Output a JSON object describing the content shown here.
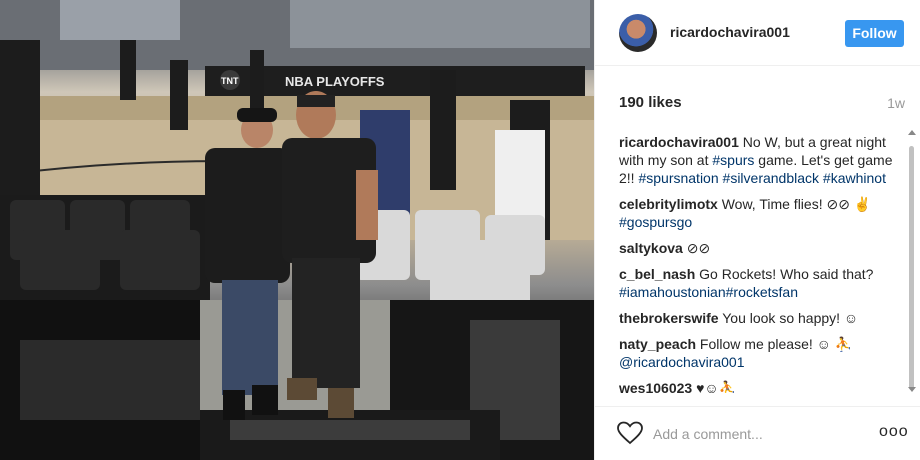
{
  "post": {
    "username": "ricardochavira001",
    "follow_label": "Follow",
    "likes": "190 likes",
    "age": "1w",
    "comment_placeholder": "Add a comment...",
    "more_label": "ooo"
  },
  "photo": {
    "court_banner": "NBA PLAYOFFS",
    "tnt_logo": "TNT"
  },
  "comments": [
    {
      "user": "ricardochavira001",
      "text": " No W, but a great night with my son at ",
      "tags": [
        "#spurs",
        "#spursnation",
        "#silverandblack",
        "#kawhinot"
      ],
      "text2": " game. Let's get game 2!! "
    },
    {
      "user": "celebritylimotx",
      "text": " Wow, Time flies! ⊘⊘ ",
      "tags": [
        "#gospursgo"
      ],
      "emoji": "✌"
    },
    {
      "user": "saltykova",
      "text": " ⊘⊘"
    },
    {
      "user": "c_bel_nash",
      "text": " Go Rockets! Who said that? ",
      "tags": [
        "#iamahoustonian#rocketsfan"
      ]
    },
    {
      "user": "thebrokerswife",
      "text": " You look so happy! ☺"
    },
    {
      "user": "naty_peach",
      "text": " Follow me please! ☺ ⛹ ",
      "tags": [
        "@ricardochavira001"
      ]
    },
    {
      "user": "wes106023",
      "text": " ♥☺⛹"
    }
  ],
  "colors": {
    "follow_bg": "#3897f0",
    "tag": "#003569",
    "text": "#262626",
    "muted": "#999999"
  }
}
